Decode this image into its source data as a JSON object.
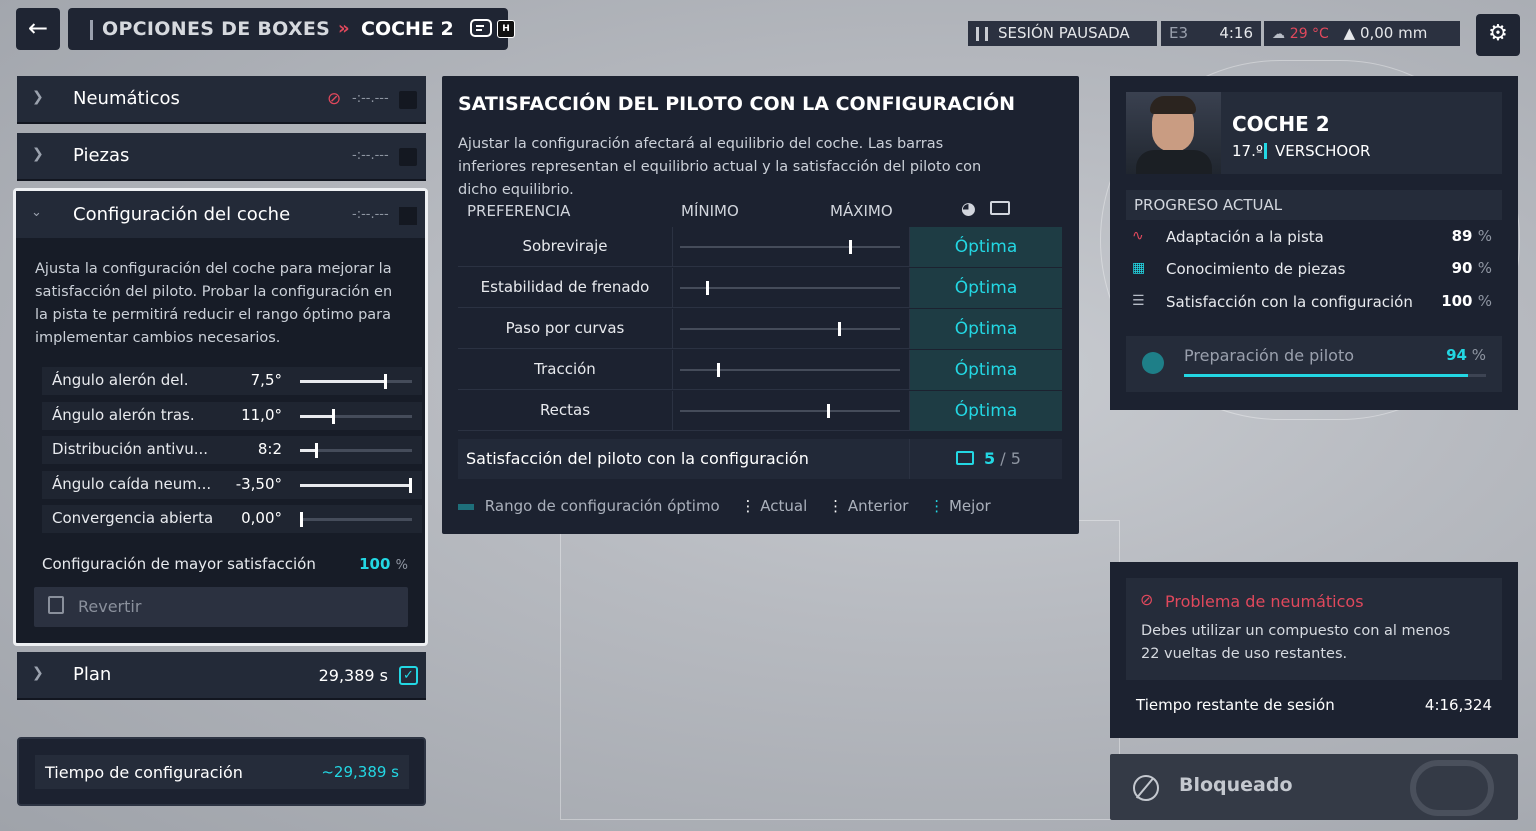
{
  "header": {
    "back_icon": "arrow-left-icon",
    "section": "OPCIONES DE BOXES",
    "separator": "»",
    "car": "COCHE 2",
    "swap_hotkey": "H"
  },
  "status": {
    "session": "SESIÓN PAUSADA",
    "event": "E3",
    "time": "4:16",
    "temperature": "29 °C",
    "rain": "0,00 mm"
  },
  "sidebar": {
    "tyres": {
      "label": "Neumáticos",
      "value": "-:--.---"
    },
    "parts": {
      "label": "Piezas",
      "value": "-:--.---"
    },
    "setup": {
      "label": "Configuración del coche",
      "value": "-:--.---",
      "description": "Ajusta la configuración del coche para mejorar la satisfacción del piloto. Probar la configuración en la pista te permitirá reducir el rango óptimo para implementar cambios necesarios.",
      "rows": [
        {
          "name": "Ángulo alerón del.",
          "value": "7,5°",
          "level": 0.75
        },
        {
          "name": "Ángulo alerón tras.",
          "value": "11,0°",
          "level": 0.29
        },
        {
          "name": "Distribución antivu...",
          "value": "8:2",
          "level": 0.13
        },
        {
          "name": "Ángulo caída neum...",
          "value": "-3,50°",
          "level": 1.0
        },
        {
          "name": "Convergencia abierta",
          "value": "0,00°",
          "level": 0.0
        }
      ],
      "best_label": "Configuración de mayor satisfacción",
      "best_value": "100",
      "best_unit": "%",
      "revert": "Revertir"
    },
    "plan": {
      "label": "Plan",
      "value": "29,389 s"
    },
    "config_time": {
      "label": "Tiempo de configuración",
      "value": "~29,389 s"
    }
  },
  "satisfaction": {
    "title": "SATISFACCIÓN DEL PILOTO CON LA CONFIGURACIÓN",
    "description": "Ajustar la configuración afectará al equilibrio del coche. Las barras inferiores representan el equilibrio actual y la satisfacción del piloto con dicho equilibrio.",
    "col_pref": "PREFERENCIA",
    "col_min": "MÍNIMO",
    "col_max": "MÁXIMO",
    "rows": [
      {
        "name": "Sobreviraje",
        "level": 0.77,
        "status": "Óptima"
      },
      {
        "name": "Estabilidad de frenado",
        "level": 0.12,
        "status": "Óptima"
      },
      {
        "name": "Paso por curvas",
        "level": 0.72,
        "status": "Óptima"
      },
      {
        "name": "Tracción",
        "level": 0.17,
        "status": "Óptima"
      },
      {
        "name": "Rectas",
        "level": 0.67,
        "status": "Óptima"
      }
    ],
    "total_label": "Satisfacción del piloto con la configuración",
    "total_value": "5",
    "total_max": "/ 5",
    "legend": {
      "range": "Rango de configuración óptimo",
      "current": "Actual",
      "previous": "Anterior",
      "best": "Mejor"
    }
  },
  "driver": {
    "car": "COCHE 2",
    "position": "17.º",
    "name": "VERSCHOOR",
    "progress_title": "PROGRESO ACTUAL",
    "progress": [
      {
        "label": "Adaptación a la pista",
        "value": "89",
        "unit": "%"
      },
      {
        "label": "Conocimiento de piezas",
        "value": "90",
        "unit": "%"
      },
      {
        "label": "Satisfacción con la configuración",
        "value": "100",
        "unit": "%"
      }
    ],
    "prep_label": "Preparación de piloto",
    "prep_value": "94",
    "prep_unit": "%",
    "prep_level": 0.94
  },
  "warning": {
    "title": "Problema de neumáticos",
    "text": "Debes utilizar un compuesto con al menos 22 vueltas de uso restantes.",
    "time_label": "Tiempo restante de sesión",
    "time_value": "4:16,324"
  },
  "locked": {
    "label": "Bloqueado"
  },
  "colors": {
    "accent": "#23d7e3",
    "danger": "#e0485c",
    "panel": "#1c2230"
  }
}
